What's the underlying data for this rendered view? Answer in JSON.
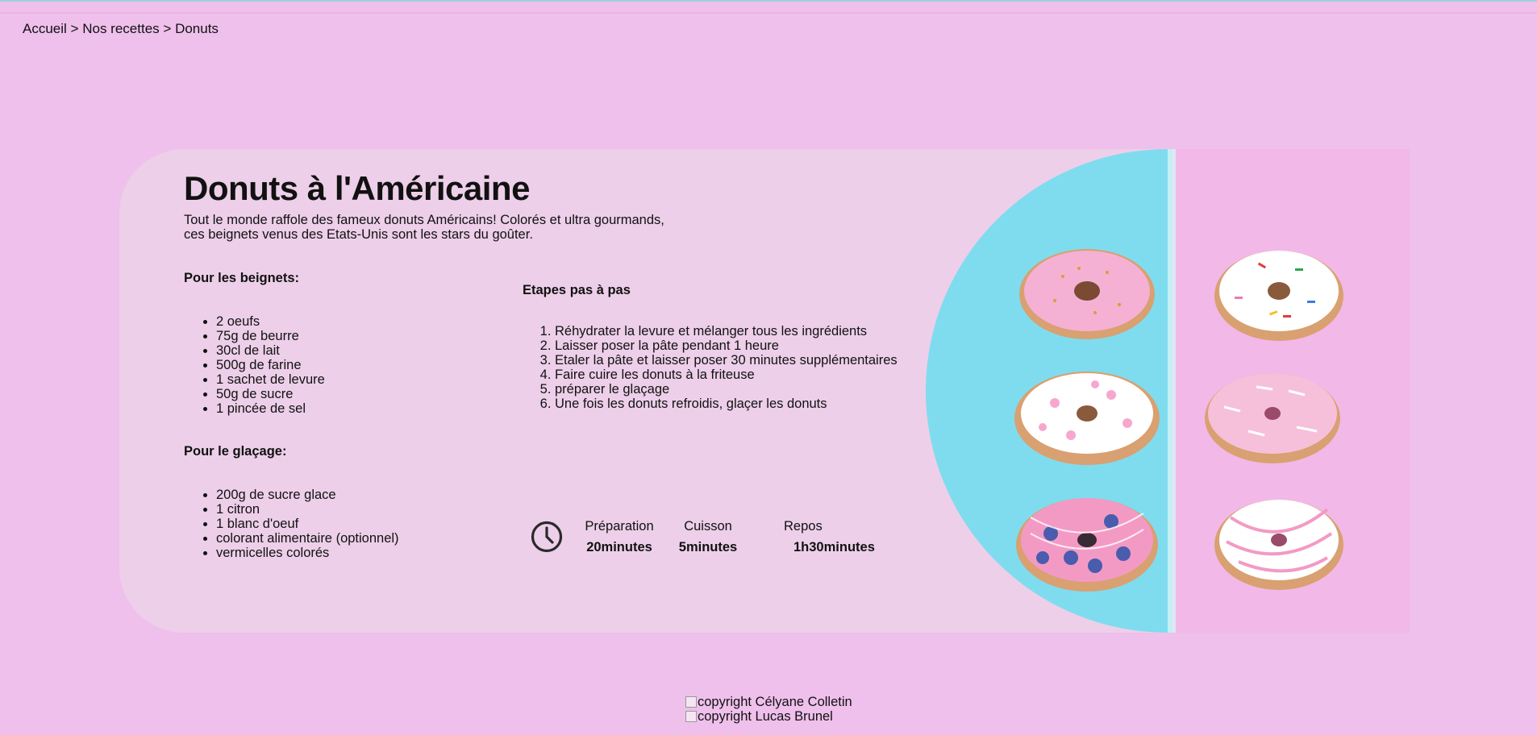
{
  "breadcrumb": {
    "home": "Accueil",
    "section": "Nos recettes",
    "current": "Donuts",
    "separator": ">"
  },
  "recipe": {
    "title": "Donuts à l'Américaine",
    "intro_line1": "Tout le monde raffole des fameux donuts Américains! Colorés et ultra gourmands,",
    "intro_line2": "ces beignets venus des Etats-Unis sont les stars du goûter.",
    "beignets_heading": "Pour les beignets:",
    "beignets": [
      "2 oeufs",
      "75g de beurre",
      "30cl de lait",
      "500g de farine",
      "1 sachet de levure",
      "50g de sucre",
      "1 pincée de sel"
    ],
    "glacage_heading": "Pour le glaçage:",
    "glacage": [
      "200g de sucre glace",
      "1 citron",
      "1 blanc d'oeuf",
      "colorant alimentaire (optionnel)",
      "vermicelles colorés"
    ],
    "steps_heading": "Etapes pas à pas",
    "steps": [
      "Réhydrater la levure et mélanger tous les ingrédients",
      "Laisser poser la pâte pendant 1 heure",
      "Etaler la pâte et laisser poser 30 minutes supplémentaires",
      "Faire cuire les donuts à la friteuse",
      "préparer le glaçage",
      "Une fois les donuts refroidis, glaçer les donuts"
    ],
    "times": {
      "icon": "clock-icon",
      "preparation_label": "Préparation",
      "preparation_value": "20minutes",
      "cuisson_label": "Cuisson",
      "cuisson_value": "5minutes",
      "repos_label": "Repos",
      "repos_value": "1h30minutes"
    },
    "photo_alt_icon": "donuts-photo"
  },
  "footer": {
    "credit1": "copyright Célyane Colletin",
    "credit2": "copyright Lucas Brunel"
  },
  "colors": {
    "background": "#efc0ec",
    "card": "#edcfe9",
    "photo_cyan": "#7fdcee",
    "photo_pink": "#f2b8e8"
  }
}
